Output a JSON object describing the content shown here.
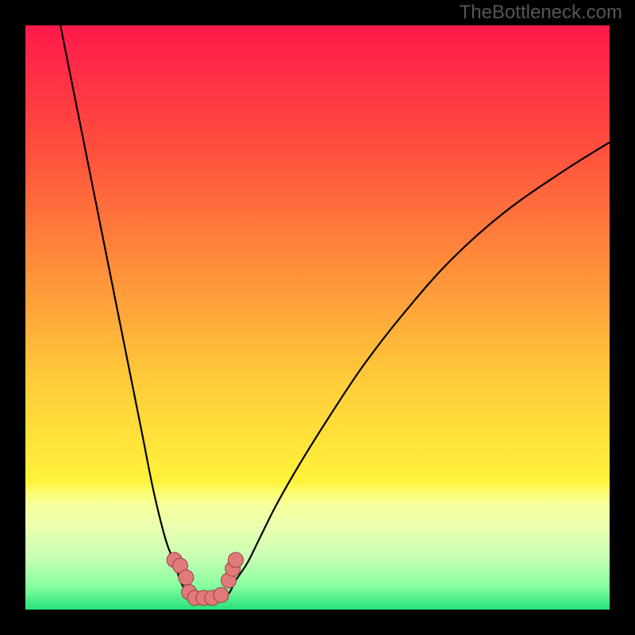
{
  "watermark": {
    "text": "TheBottleneck.com"
  },
  "chart_data": {
    "type": "line",
    "title": "",
    "xlabel": "",
    "ylabel": "",
    "xlim": [
      0,
      100
    ],
    "ylim": [
      0,
      100
    ],
    "gradient_stops": [
      {
        "offset": 0,
        "color": "#ff1a4b"
      },
      {
        "offset": 20,
        "color": "#ff4b3e"
      },
      {
        "offset": 40,
        "color": "#ff8a3a"
      },
      {
        "offset": 60,
        "color": "#ffc93a"
      },
      {
        "offset": 78,
        "color": "#fff23a"
      },
      {
        "offset": 80,
        "color": "#fbff70"
      },
      {
        "offset": 82,
        "color": "#f7ff9b"
      },
      {
        "offset": 86,
        "color": "#e9ffb0"
      },
      {
        "offset": 91,
        "color": "#c9ffb5"
      },
      {
        "offset": 96,
        "color": "#87ff9f"
      },
      {
        "offset": 100,
        "color": "#25e27a"
      }
    ],
    "series": [
      {
        "name": "curve-left",
        "x": [
          6,
          8,
          10,
          12,
          14,
          16,
          18,
          20,
          22,
          24,
          25.5,
          26.5,
          27.5,
          28
        ],
        "y": [
          100,
          90,
          80,
          70,
          60,
          50,
          40,
          30,
          20,
          12,
          8,
          5,
          3,
          2
        ]
      },
      {
        "name": "curve-right",
        "x": [
          34,
          35,
          36,
          38,
          40,
          43,
          47,
          52,
          58,
          65,
          73,
          82,
          92,
          100
        ],
        "y": [
          2,
          3,
          5,
          8,
          12,
          18,
          25,
          33,
          42,
          51,
          60,
          68,
          75,
          80
        ]
      }
    ],
    "flat_segment": {
      "x0": 28,
      "x1": 34,
      "y": 2
    },
    "markers": {
      "color": "#e17a7a",
      "outline": "#9a3f3f",
      "points": [
        {
          "x": 25.5,
          "y": 8.5
        },
        {
          "x": 26.5,
          "y": 7.5
        },
        {
          "x": 27.5,
          "y": 5.5
        },
        {
          "x": 28.0,
          "y": 3.0
        },
        {
          "x": 29.0,
          "y": 2.0
        },
        {
          "x": 30.5,
          "y": 2.0
        },
        {
          "x": 32.0,
          "y": 2.0
        },
        {
          "x": 33.5,
          "y": 2.5
        },
        {
          "x": 34.8,
          "y": 5.0
        },
        {
          "x": 35.5,
          "y": 7.0
        },
        {
          "x": 36.0,
          "y": 8.5
        }
      ]
    }
  }
}
